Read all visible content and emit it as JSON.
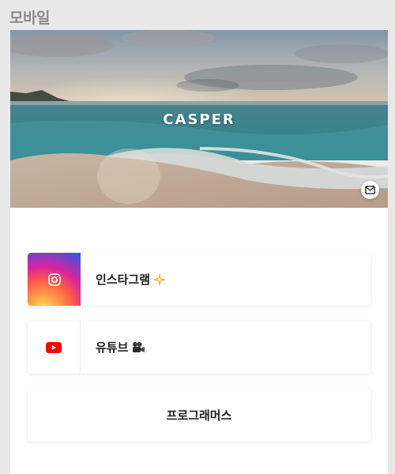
{
  "page_label": "모바일",
  "profile": {
    "name": "CASPER",
    "contact_icon": "mail-icon"
  },
  "links": [
    {
      "label": "인스타그램",
      "icon": "instagram-icon",
      "emoji": "sparkle-star",
      "accent": "#d6249f"
    },
    {
      "label": "유튜브",
      "icon": "youtube-icon",
      "emoji": "movie-camera",
      "accent": "#ff0000"
    },
    {
      "label": "프로그래머스",
      "icon": "",
      "emoji": ""
    }
  ]
}
